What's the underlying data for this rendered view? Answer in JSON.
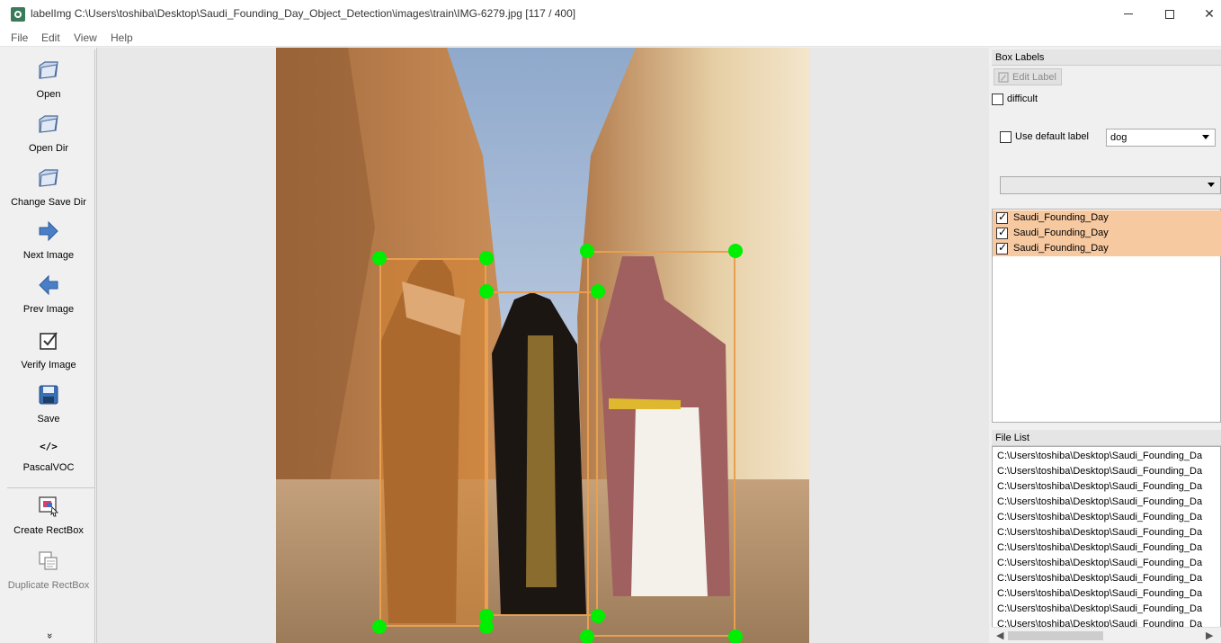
{
  "window": {
    "title": "labelImg C:\\Users\\toshiba\\Desktop\\Saudi_Founding_Day_Object_Detection\\images\\train\\IMG-6279.jpg [117 / 400]",
    "minimize": "—",
    "maximize": "□",
    "close": "✕"
  },
  "menu": [
    "File",
    "Edit",
    "View",
    "Help"
  ],
  "toolbar": {
    "open": "Open",
    "open_dir": "Open Dir",
    "change_save_dir": "Change Save Dir",
    "next_image": "Next Image",
    "prev_image": "Prev Image",
    "verify_image": "Verify Image",
    "save": "Save",
    "format_icon_text": "</>",
    "format": "PascalVOC",
    "create_rectbox": "Create RectBox",
    "duplicate_rectbox": "Duplicate RectBox",
    "more": "»"
  },
  "box_labels": {
    "title": "Box Labels",
    "edit_label": "Edit Label",
    "difficult": "difficult",
    "use_default_label": "Use default label",
    "default_label_value": "dog",
    "labels": [
      {
        "text": "Saudi_Founding_Day",
        "checked": true
      },
      {
        "text": "Saudi_Founding_Day",
        "checked": true
      },
      {
        "text": "Saudi_Founding_Day",
        "checked": true
      }
    ]
  },
  "file_list": {
    "title": "File List",
    "items": [
      "C:\\Users\\toshiba\\Desktop\\Saudi_Founding_Da",
      "C:\\Users\\toshiba\\Desktop\\Saudi_Founding_Da",
      "C:\\Users\\toshiba\\Desktop\\Saudi_Founding_Da",
      "C:\\Users\\toshiba\\Desktop\\Saudi_Founding_Da",
      "C:\\Users\\toshiba\\Desktop\\Saudi_Founding_Da",
      "C:\\Users\\toshiba\\Desktop\\Saudi_Founding_Da",
      "C:\\Users\\toshiba\\Desktop\\Saudi_Founding_Da",
      "C:\\Users\\toshiba\\Desktop\\Saudi_Founding_Da",
      "C:\\Users\\toshiba\\Desktop\\Saudi_Founding_Da",
      "C:\\Users\\toshiba\\Desktop\\Saudi_Founding_Da",
      "C:\\Users\\toshiba\\Desktop\\Saudi_Founding_Da",
      "C:\\Users\\toshiba\\Desktop\\Saudi_Founding_Da"
    ]
  },
  "colors": {
    "box_stroke": "#e8a050",
    "box_fill": "#d68432",
    "handle": "#00ee00",
    "label_row_bg": "#f6c9a0"
  }
}
